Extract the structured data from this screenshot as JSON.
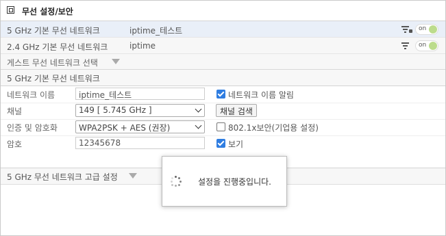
{
  "title": "무선 설정/보안",
  "networks": [
    {
      "label": "5 GHz 기본 무선 네트워크",
      "ssid": "iptime_테스트",
      "toggle": "on"
    },
    {
      "label": "2.4 GHz 기본 무선 네트워크",
      "ssid": "iptime",
      "toggle": "on"
    }
  ],
  "guest_select_label": "게스트 무선 네트워크 선택",
  "panel": {
    "header": "5 GHz 기본 무선 네트워크",
    "ssid_label": "네트워크 이름",
    "ssid_value": "iptime_테스트",
    "broadcast_label": "네트워크 이름 알림",
    "channel_label": "채널",
    "channel_value": "149 [ 5.745 GHz ]",
    "channel_scan_button": "채널 검색",
    "auth_label": "인증 및 암호화",
    "auth_value": "WPA2PSK + AES (권장)",
    "enterprise_label": "802.1x보안(기업용 설정)",
    "password_label": "암호",
    "password_value": "12345678",
    "show_label": "보기"
  },
  "advanced_label": "5 GHz 무선 네트워크 고급 설정",
  "modal_text": "설정을 진행중입니다.",
  "colors": {
    "selected_row": "#e9eff8",
    "toggle_knob": "#bcdc8c",
    "checkbox": "#2f7de1"
  }
}
